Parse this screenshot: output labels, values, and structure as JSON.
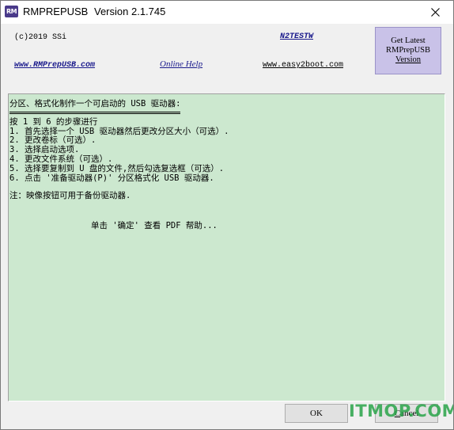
{
  "titlebar": {
    "icon_text": "RM",
    "app_name": "RMPREPUSB",
    "version": "Version 2.1.745",
    "close_glyph": "close-icon"
  },
  "header": {
    "copyright": "(c)2019 SSi",
    "nztestw": "N2TESTW",
    "site_link": "www.RMPrepUSB.com",
    "online_help": "Online Help",
    "easy2boot": "www.easy2boot.com",
    "get_latest": {
      "line1": "Get Latest",
      "line2": "RMPrepUSB",
      "line3": "Version"
    }
  },
  "info": {
    "heading": "分区、格式化制作一个可启动的 USB 驱动器:",
    "lines": [
      "按 1 到 6 的步骤进行",
      "1. 首先选择一个 USB 驱动器然后更改分区大小（可选）.",
      "2. 更改卷标（可选）.",
      "3. 选择启动选项.",
      "4. 更改文件系统（可选）.",
      "5. 选择要复制到 U 盘的文件,然后勾选复选框（可选）.",
      "6. 点击 '准备驱动器(P)' 分区格式化 USB 驱动器."
    ],
    "note": "注：映像按钮可用于备份驱动器.",
    "footer": "单击 '确定' 查看 PDF 帮助..."
  },
  "buttons": {
    "ok": "OK",
    "cancel_prefix": "",
    "cancel_ul": "C",
    "cancel_rest": "ancel"
  },
  "watermark": "ITMOP.COM",
  "colors": {
    "panel_bg": "#cce8cf",
    "get_latest_bg": "#c9c2e8",
    "link_color": "#1a1a8c",
    "watermark": "#2aa44a"
  }
}
